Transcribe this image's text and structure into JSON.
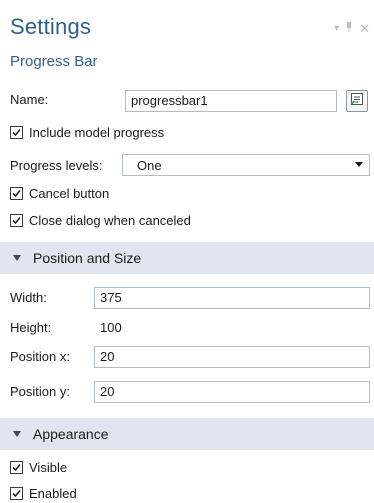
{
  "settings": {
    "title": "Settings",
    "subtitle": "Progress Bar"
  },
  "window_controls": [
    "pin-icon",
    "dropdown-icon",
    "close-icon"
  ],
  "general": {
    "name_label": "Name:",
    "name_value": "progressbar1",
    "include_model_progress": {
      "label": "Include model progress",
      "checked": true
    },
    "progress_levels_label": "Progress levels:",
    "progress_levels_value": "One",
    "cancel_button": {
      "label": "Cancel button",
      "checked": true
    },
    "close_dialog": {
      "label": "Close dialog when canceled",
      "checked": true
    }
  },
  "position_and_size": {
    "header": "Position and Size",
    "width_label": "Width:",
    "width_value": "375",
    "height_label": "Height:",
    "height_value": "100",
    "position_x_label": "Position x:",
    "position_x_value": "20",
    "position_y_label": "Position y:",
    "position_y_value": "20"
  },
  "appearance": {
    "header": "Appearance",
    "visible": {
      "label": "Visible",
      "checked": true
    },
    "enabled": {
      "label": "Enabled",
      "checked": true
    }
  },
  "colors": {
    "title": "#2d5f8f",
    "section_bg": "#dfe6ef"
  }
}
